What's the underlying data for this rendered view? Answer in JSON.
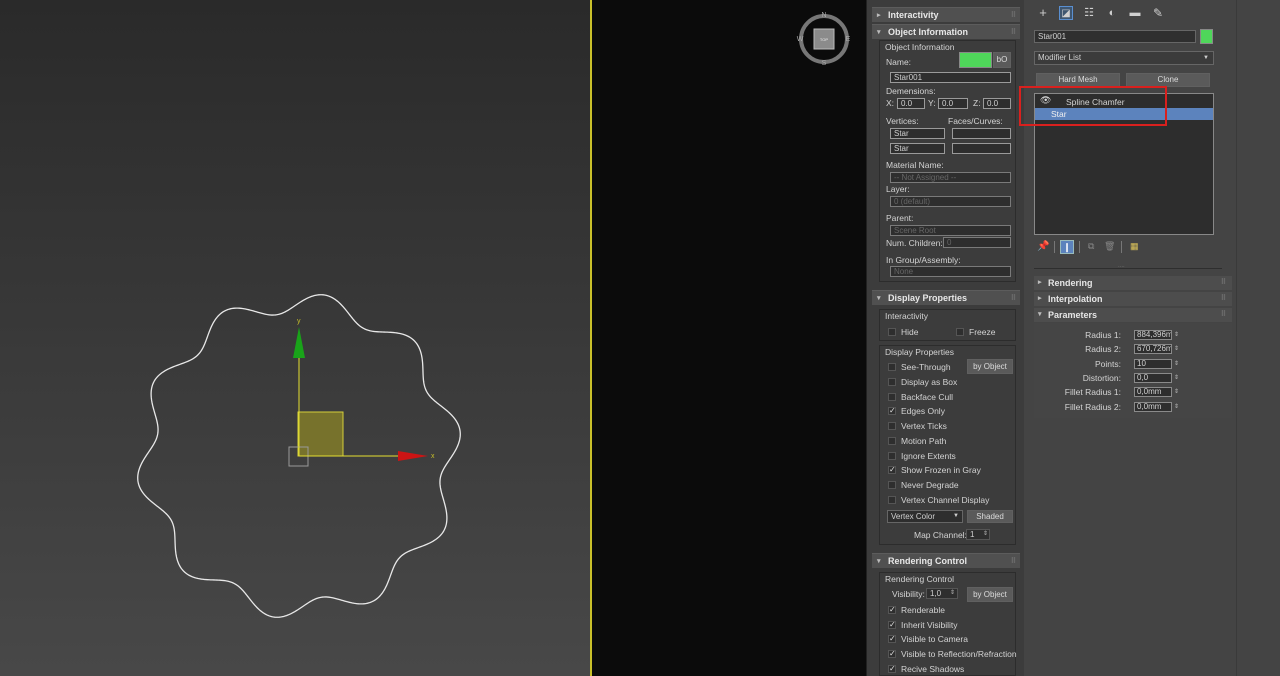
{
  "viewport": {
    "gizmo_axis_y": "y",
    "gizmo_axis_x": "x",
    "viewcube": {
      "n": "N",
      "s": "S",
      "e": "E",
      "w": "W",
      "face": "TOP"
    }
  },
  "object_info_panel": {
    "interactivity_rollup": "Interactivity",
    "object_information_rollup": "Object Information",
    "group_title": "Object Information",
    "name_label": "Name:",
    "name_button": "bO",
    "name_value": "Star001",
    "dimensions_label": "Demensions:",
    "x_label": "X:",
    "x_value": "0.0",
    "y_label": "Y:",
    "y_value": "0.0",
    "z_label": "Z:",
    "z_value": "0.0",
    "vertices_label": "Vertices:",
    "faces_label": "Faces/Curves:",
    "vertices_value_1": "Star",
    "vertices_value_2": "Star",
    "material_label": "Material Name:",
    "material_value": "-- Not Assigned --",
    "layer_label": "Layer:",
    "layer_value": "0 (default)",
    "parent_label": "Parent:",
    "parent_value": "Scene Root",
    "children_label": "Num. Children:",
    "children_value": "0",
    "group_label": "In Group/Assembly:",
    "group_value": "None",
    "display_properties_rollup": "Display Properties",
    "interactivity_group": "Interactivity",
    "hide": "Hide",
    "freeze": "Freeze",
    "display_props_group": "Display Properties",
    "see_through": "See-Through",
    "by_object": "by Object",
    "display_as_box": "Display as Box",
    "backface_cull": "Backface Cull",
    "edges_only": "Edges Only",
    "vertex_ticks": "Vertex Ticks",
    "motion_path": "Motion Path",
    "ignore_extents": "Ignore Extents",
    "show_frozen_gray": "Show Frozen in Gray",
    "never_degrade": "Never Degrade",
    "vertex_channel_display": "Vertex Channel Display",
    "vertex_color": "Vertex Color",
    "shaded": "Shaded",
    "map_channel_label": "Map Channel:",
    "map_channel_value": "1",
    "rendering_control_rollup": "Rendering Control",
    "rendering_control_group": "Rendering Control",
    "visibility_label": "Visibility:",
    "visibility_value": "1,0",
    "by_object_2": "by Object",
    "renderable": "Renderable",
    "inherit_visibility": "Inherit Visibility",
    "visible_to_camera": "Visible to Camera",
    "visible_to_reflection": "Visible to Reflection/Refraction",
    "receive_shadows": "Recive Shadows"
  },
  "modify_panel": {
    "object_name": "Star001",
    "object_color": "#4fd65a",
    "modifier_list": "Modifier List",
    "hard_mesh": "Hard Mesh",
    "clone": "Clone",
    "stack": [
      {
        "label": "Spline Chamfer"
      },
      {
        "label": "Star"
      }
    ],
    "rendering": "Rendering",
    "interpolation": "Interpolation",
    "parameters": "Parameters",
    "params": [
      {
        "label": "Radius 1:",
        "value": "884,396mi"
      },
      {
        "label": "Radius 2:",
        "value": "670,726mi"
      },
      {
        "label": "Points:",
        "value": "10"
      },
      {
        "label": "Distortion:",
        "value": "0,0"
      },
      {
        "label": "Fillet Radius 1:",
        "value": "0,0mm"
      },
      {
        "label": "Fillet Radius 2:",
        "value": "0,0mm"
      }
    ]
  }
}
